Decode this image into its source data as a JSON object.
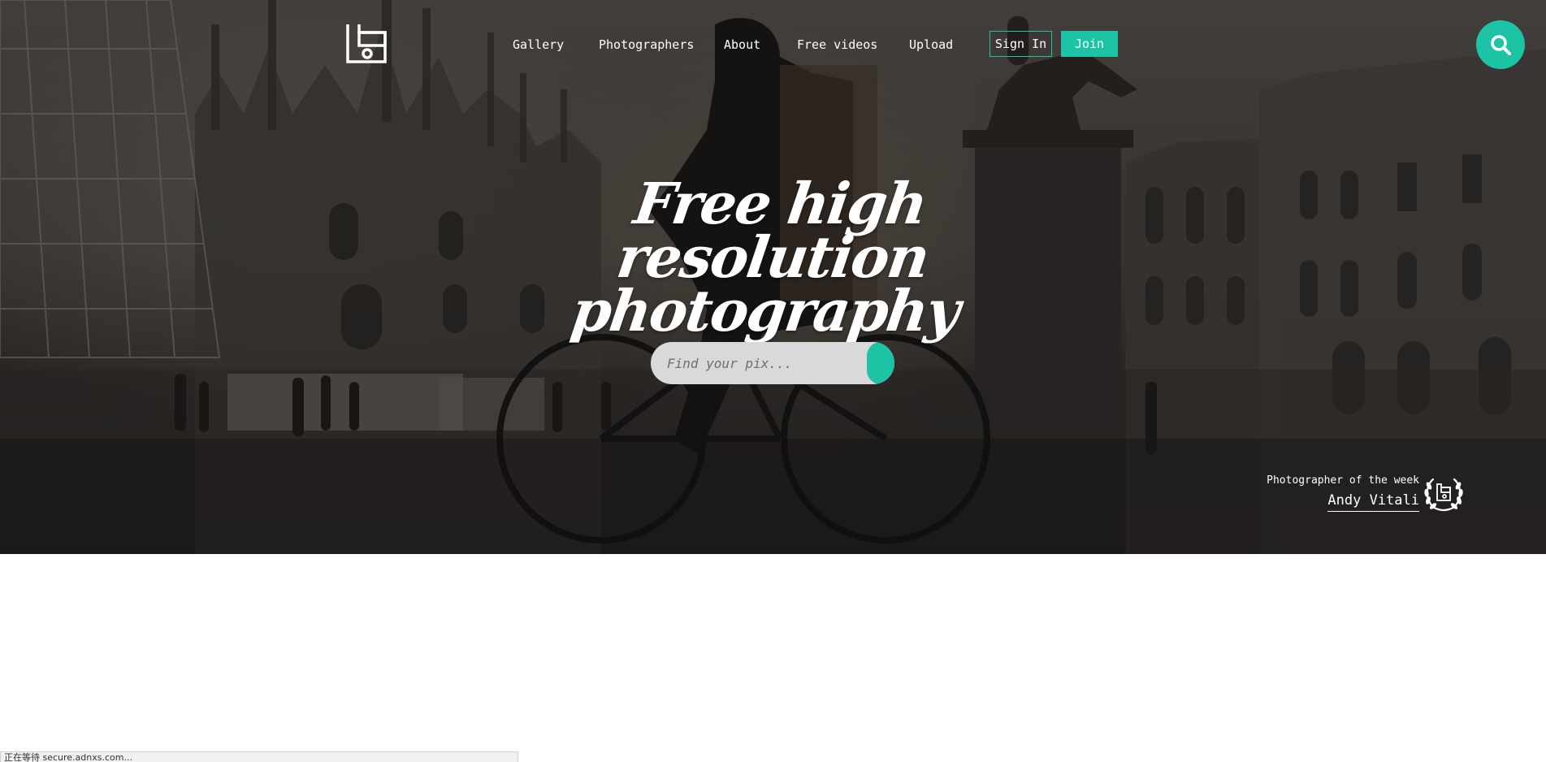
{
  "nav": {
    "items": [
      {
        "label": "Gallery"
      },
      {
        "label": "Photographers"
      },
      {
        "label": "About"
      },
      {
        "label": "Free videos"
      },
      {
        "label": "Upload"
      }
    ],
    "signin_label": "Sign In",
    "join_label": "Join"
  },
  "hero": {
    "headline_line1": "Free high resolution",
    "headline_line2": "photography"
  },
  "search": {
    "placeholder": "Find your pix..."
  },
  "photographer_of_week": {
    "label": "Photographer of the week",
    "name": "Andy Vitali"
  },
  "status_bar": {
    "text": "正在等待 secure.adnxs.com..."
  },
  "icons": {
    "logo": "site-logo",
    "search": "search-icon",
    "laurel": "laurel-badge-icon"
  },
  "colors": {
    "accent": "#1cc3a4",
    "text": "#ffffff"
  }
}
